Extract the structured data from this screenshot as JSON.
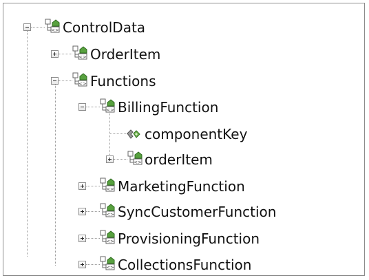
{
  "tree": {
    "root": {
      "label": "ControlData",
      "icon": "complex-element-icon",
      "expanded": true,
      "children": [
        {
          "label": "OrderItem",
          "icon": "complex-element-icon",
          "expanded": false
        },
        {
          "label": "Functions",
          "icon": "complex-element-icon",
          "expanded": true,
          "children": [
            {
              "label": "BillingFunction",
              "icon": "complex-element-icon",
              "expanded": true,
              "children": [
                {
                  "label": "componentKey",
                  "icon": "attribute-icon"
                },
                {
                  "label": "orderItem",
                  "icon": "complex-element-icon",
                  "expanded": false
                }
              ]
            },
            {
              "label": "MarketingFunction",
              "icon": "complex-element-icon",
              "expanded": false
            },
            {
              "label": "SyncCustomerFunction",
              "icon": "complex-element-icon",
              "expanded": false
            },
            {
              "label": "ProvisioningFunction",
              "icon": "complex-element-icon",
              "expanded": false
            },
            {
              "label": "CollectionsFunction",
              "icon": "complex-element-icon",
              "expanded": false
            }
          ]
        }
      ]
    }
  }
}
